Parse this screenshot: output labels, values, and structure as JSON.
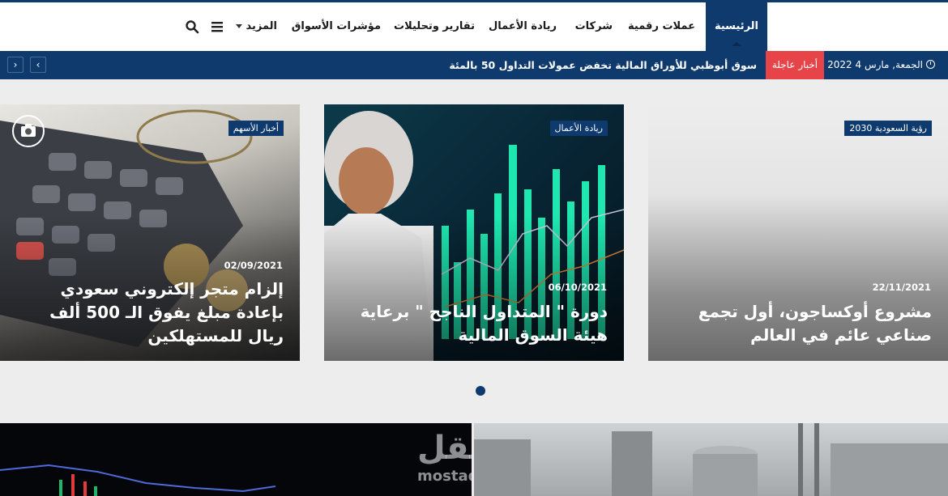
{
  "nav": {
    "items": [
      {
        "label": "الرئيسية"
      },
      {
        "label": "عملات رقمية"
      },
      {
        "label": "شركات"
      },
      {
        "label": "ريادة الأعمال"
      },
      {
        "label": "تقارير وتحليلات"
      },
      {
        "label": "مؤشرات الأسواق"
      },
      {
        "label": "المزيد"
      }
    ],
    "icons": {
      "menu": "hamburger-icon",
      "search": "search-icon"
    }
  },
  "ticker": {
    "date": "الجمعة, مارس 4 2022",
    "badge": "أخبار عاجلة",
    "headline": "سوق أبوظبي للأوراق المالية تخفض عمولات التداول 50 بالمئة",
    "prev": "‹",
    "next": "›"
  },
  "slides": [
    {
      "category": "رؤية السعودية 2030",
      "date": "22/11/2021",
      "title": "مشروع أوكساجون، أول تجمع صناعي عائم في العالم"
    },
    {
      "category": "ريادة الأعمال",
      "date": "06/10/2021",
      "title": "دورة \" المتداول الناجح \" برعاية هيئة السوق المالية"
    },
    {
      "category": "أخبار الأسهم",
      "date": "02/09/2021",
      "title": "إلزام متجر إلكتروني سعودي بإعادة مبلغ يفوق الـ 500 ألف ريال للمستهلكين"
    }
  ],
  "watermark": {
    "arabic": "مستقل",
    "latin": "mostaql"
  },
  "colors": {
    "brand": "#0f3a6e",
    "breaking": "#e7444a",
    "background": "#ededed"
  }
}
